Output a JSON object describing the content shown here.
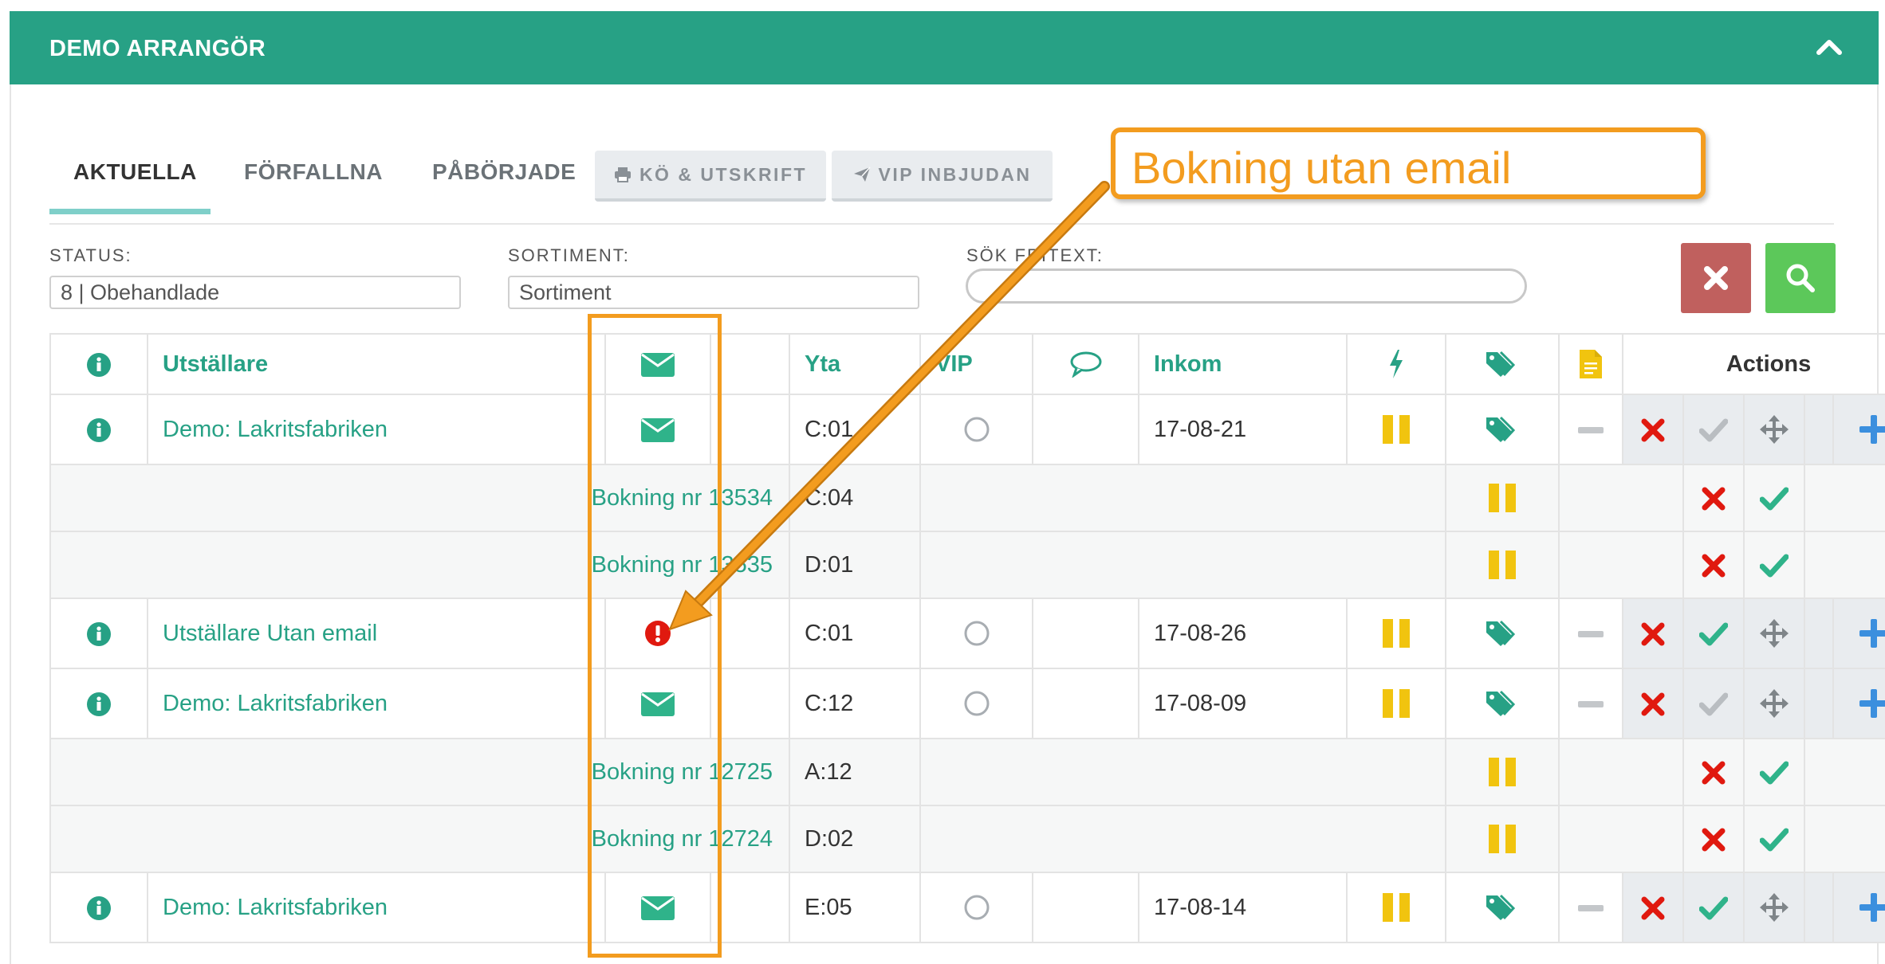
{
  "header": {
    "title": "DEMO ARRANGÖR",
    "collapse_icon": "chevron-up-icon"
  },
  "tabs": [
    {
      "label": "AKTUELLA",
      "active": true
    },
    {
      "label": "FÖRFALLNA",
      "active": false
    },
    {
      "label": "PÅBÖRJADE",
      "active": false
    }
  ],
  "tool_buttons": {
    "queue_print": "KÖ & UTSKRIFT",
    "vip_invite": "VIP INBJUDAN"
  },
  "filters": {
    "status_label": "STATUS:",
    "status_value": "8 | Obehandlade",
    "sortiment_label": "SORTIMENT:",
    "sortiment_value": "Sortiment",
    "search_label": "SÖK FRITEXT:",
    "search_placeholder": ""
  },
  "table": {
    "columns": {
      "exhibitor": "Utställare",
      "area": "Yta",
      "vip": "VIP",
      "incoming": "Inkom",
      "actions": "Actions"
    },
    "rows": [
      {
        "type": "exhibitor",
        "name": "Demo: Lakritsfabriken",
        "email": "envelope",
        "area": "C:01",
        "date": "17-08-21",
        "approve": "grey"
      },
      {
        "type": "booking",
        "label": "Bokning nr 13534",
        "area": "C:04"
      },
      {
        "type": "booking",
        "label": "Bokning nr 13535",
        "area": "D:01"
      },
      {
        "type": "exhibitor",
        "name": "Utställare Utan email",
        "email": "missing",
        "area": "C:01",
        "date": "17-08-26",
        "approve": "green"
      },
      {
        "type": "exhibitor",
        "name": "Demo: Lakritsfabriken",
        "email": "envelope",
        "area": "C:12",
        "date": "17-08-09",
        "approve": "grey"
      },
      {
        "type": "booking",
        "label": "Bokning nr 12725",
        "area": "A:12"
      },
      {
        "type": "booking",
        "label": "Bokning nr 12724",
        "area": "D:02"
      },
      {
        "type": "exhibitor",
        "name": "Demo: Lakritsfabriken",
        "email": "envelope",
        "area": "E:05",
        "date": "17-08-14",
        "approve": "green"
      }
    ]
  },
  "annotation": {
    "text": "Bokning utan email"
  },
  "colors": {
    "brand": "#27a185",
    "pause": "#f1c40f",
    "danger": "#e0190f",
    "success": "#2fb38a",
    "plus": "#3b8fde",
    "delete_btn": "#c0605e",
    "search_btn": "#5cc85a",
    "annotation": "#f39c1f"
  }
}
